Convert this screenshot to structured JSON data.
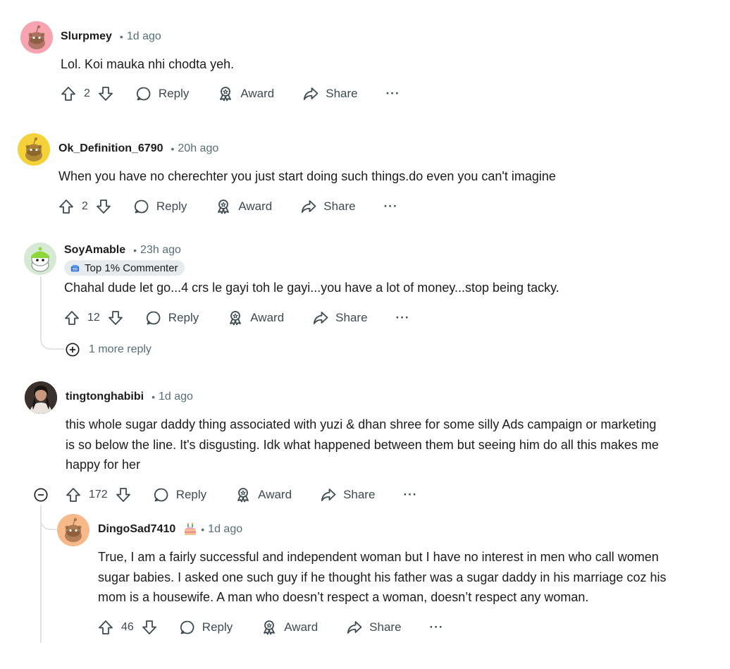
{
  "comments": [
    {
      "username": "Slurpmey",
      "time": "1d ago",
      "body": "Lol. Koi mauka nhi chodta yeh.",
      "votes": "2",
      "reply": "Reply",
      "award": "Award",
      "share": "Share",
      "more": "···",
      "avatar_color": "#f7a4b0"
    },
    {
      "username": "Ok_Definition_6790",
      "time": "20h ago",
      "body": "When you have no cherechter you just start doing such things.do even you can't imagine",
      "votes": "2",
      "reply": "Reply",
      "award": "Award",
      "share": "Share",
      "more": "···",
      "avatar_color": "#f5d23a"
    },
    {
      "username": "SoyAmable",
      "time": "23h ago",
      "badge": "Top 1% Commenter",
      "body": "Chahal dude let go...4 crs le gayi toh le gayi...you have a lot of money...stop being tacky.",
      "votes": "12",
      "reply": "Reply",
      "award": "Award",
      "share": "Share",
      "more": "···",
      "more_replies": "1 more reply",
      "avatar_color": "#d6e9d4"
    },
    {
      "username": "tingtonghabibi",
      "time": "1d ago",
      "body_lines": [
        "this whole sugar daddy thing associated with yuzi & dhan shree for some silly Ads campaign or marketing",
        "is so below the line. It's disgusting. Idk what happened between them but seeing him do all this makes me",
        "happy for her"
      ],
      "votes": "172",
      "reply": "Reply",
      "award": "Award",
      "share": "Share",
      "more": "···"
    },
    {
      "username": "DingoSad7410",
      "time": "1d ago",
      "body_lines": [
        "True, I am a fairly successful and independent woman but I have no interest in men who call women",
        "sugar babies. I asked one such guy if he thought his father was a sugar daddy in his marriage coz his",
        "mom is a housewife. A man who doesn’t respect a woman, doesn’t respect any woman."
      ],
      "votes": "46",
      "reply": "Reply",
      "award": "Award",
      "share": "Share",
      "more": "···",
      "avatar_color": "#f8b98a"
    }
  ],
  "separator": "•",
  "icons": [
    "upvote-icon",
    "downvote-icon",
    "reply-bubble-icon",
    "award-icon",
    "share-arrow-icon",
    "plus-circle-icon",
    "minus-circle-icon",
    "cake-day-icon",
    "top-commenter-icon"
  ]
}
